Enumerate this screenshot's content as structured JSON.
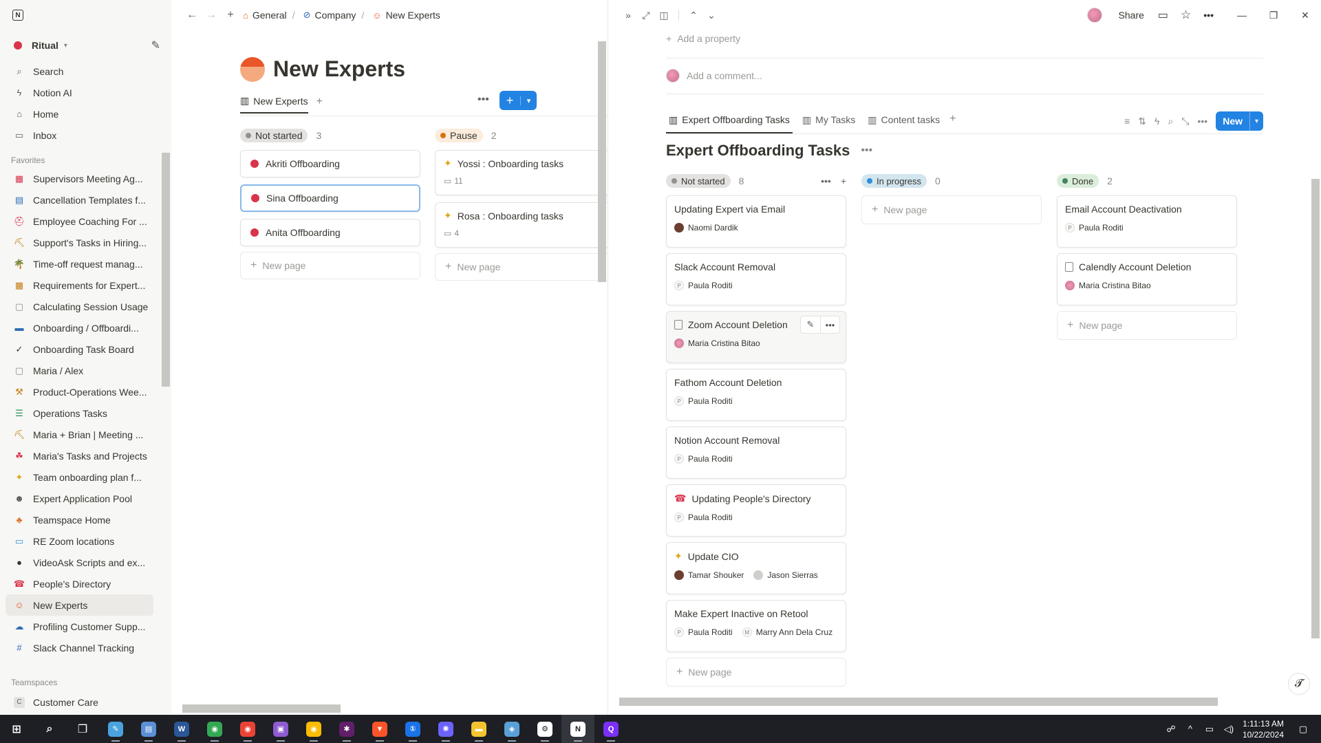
{
  "sidebar": {
    "workspace": "Ritual",
    "nav": [
      {
        "label": "Search",
        "icon": "search-icon"
      },
      {
        "label": "Notion AI",
        "icon": "ai-icon"
      },
      {
        "label": "Home",
        "icon": "home-icon"
      },
      {
        "label": "Inbox",
        "icon": "inbox-icon"
      }
    ],
    "favorites_label": "Favorites",
    "favorites": [
      {
        "label": "Supervisors Meeting Ag...",
        "icon": "▦",
        "color": "#d8344b"
      },
      {
        "label": "Cancellation Templates f...",
        "icon": "▤",
        "color": "#2f6db5"
      },
      {
        "label": "Employee Coaching For ...",
        "icon": "⛑",
        "color": "#d8344b"
      },
      {
        "label": "Support's Tasks in Hiring...",
        "icon": "⛏",
        "color": "#c47d12"
      },
      {
        "label": "Time-off request manag...",
        "icon": "🌴",
        "color": "#2e8b57"
      },
      {
        "label": "Requirements for Expert...",
        "icon": "▦",
        "color": "#c47d12"
      },
      {
        "label": "Calculating Session Usage",
        "icon": "▢",
        "color": "#888888"
      },
      {
        "label": "Onboarding / Offboardi...",
        "icon": "▬",
        "color": "#2f6db5"
      },
      {
        "label": "Onboarding Task Board",
        "icon": "✓",
        "color": "#37352f"
      },
      {
        "label": "Maria / Alex",
        "icon": "▢",
        "color": "#888888"
      },
      {
        "label": "Product-Operations Wee...",
        "icon": "⚒",
        "color": "#c47d12"
      },
      {
        "label": "Operations Tasks",
        "icon": "☰",
        "color": "#2e8b57"
      },
      {
        "label": "Maria + Brian | Meeting ...",
        "icon": "⛏",
        "color": "#c47d12"
      },
      {
        "label": "Maria's Tasks and Projects",
        "icon": "☘",
        "color": "#d8344b"
      },
      {
        "label": "Team onboarding plan f...",
        "icon": "✦",
        "color": "#e0a419"
      },
      {
        "label": "Expert Application Pool",
        "icon": "☻",
        "color": "#555555"
      },
      {
        "label": "Teamspace Home",
        "icon": "♣",
        "color": "#e07020"
      },
      {
        "label": "RE Zoom locations",
        "icon": "▭",
        "color": "#2f8fd8"
      },
      {
        "label": "VideoAsk Scripts and ex...",
        "icon": "●",
        "color": "#37352f"
      },
      {
        "label": "People's Directory",
        "icon": "☎",
        "color": "#d8344b"
      },
      {
        "label": "New Experts",
        "icon": "☺",
        "color": "#e8562a",
        "active": true
      },
      {
        "label": "Profiling Customer Supp...",
        "icon": "☁",
        "color": "#2f6db5"
      },
      {
        "label": "Slack Channel Tracking",
        "icon": "#",
        "color": "#2f6db5"
      }
    ],
    "teamspaces_label": "Teamspaces",
    "teamspace_item": "Customer Care",
    "teamspace_letter": "C"
  },
  "left": {
    "breadcrumbs": [
      "General",
      "Company",
      "New Experts"
    ],
    "title": "New Experts",
    "view_tab": "New Experts",
    "groups": [
      {
        "name": "Not started",
        "count": "3",
        "pill_bg": "#e3e2e0",
        "dot": "#91918e",
        "cards": [
          "Akriti Offboarding",
          "Sina Offboarding",
          "Anita Offboarding"
        ]
      },
      {
        "name": "Pause",
        "count": "2",
        "pill_bg": "#fbecdd",
        "dot": "#d9730d",
        "cards": [
          {
            "title": "Yossi : Onboarding tasks",
            "comments": "11"
          },
          {
            "title": "Rosa : Onboarding tasks",
            "comments": "4"
          }
        ]
      }
    ],
    "new_page": "New page"
  },
  "right": {
    "share": "Share",
    "add_property": "Add a property",
    "comment_placeholder": "Add a comment...",
    "tabs": [
      "Expert Offboarding Tasks",
      "My Tasks",
      "Content tasks"
    ],
    "new_button": "New",
    "db_title": "Expert Offboarding Tasks",
    "new_page": "New page",
    "groups": [
      {
        "name": "Not started",
        "count": "8",
        "pill_bg": "#e3e2e0",
        "dot": "#91918e",
        "cards": [
          {
            "title": "Updating Expert via Email",
            "people": [
              {
                "name": "Naomi Dardik",
                "av": "dark"
              }
            ]
          },
          {
            "title": "Slack Account Removal",
            "people": [
              {
                "name": "Paula Roditi",
                "av": "letter",
                "letter": "P"
              }
            ]
          },
          {
            "title": "Zoom Account Deletion",
            "icon": "doc",
            "hover": true,
            "people": [
              {
                "name": "Maria Cristina Bitao",
                "av": "pink"
              }
            ]
          },
          {
            "title": "Fathom Account Deletion",
            "people": [
              {
                "name": "Paula Roditi",
                "av": "letter",
                "letter": "P"
              }
            ]
          },
          {
            "title": "Notion Account Removal",
            "people": [
              {
                "name": "Paula Roditi",
                "av": "letter",
                "letter": "P"
              }
            ]
          },
          {
            "title": "Updating People's Directory",
            "icon": "☎",
            "people": [
              {
                "name": "Paula Roditi",
                "av": "letter",
                "letter": "P"
              }
            ]
          },
          {
            "title": "Update CIO",
            "icon": "✦",
            "people": [
              {
                "name": "Tamar Shouker",
                "av": "dark"
              },
              {
                "name": "Jason Sierras",
                "av": "gray"
              }
            ]
          },
          {
            "title": "Make Expert Inactive on Retool",
            "people": [
              {
                "name": "Paula Roditi",
                "av": "letter",
                "letter": "P"
              },
              {
                "name": "Marry Ann Dela Cruz",
                "av": "letter",
                "letter": "M"
              }
            ]
          }
        ]
      },
      {
        "name": "In progress",
        "count": "0",
        "pill_bg": "#d3e5ef",
        "dot": "#2f8fd8",
        "cards": []
      },
      {
        "name": "Done",
        "count": "2",
        "pill_bg": "#dbeddb",
        "dot": "#448361",
        "cards": [
          {
            "title": "Email Account Deactivation",
            "people": [
              {
                "name": "Paula Roditi",
                "av": "letter",
                "letter": "P"
              }
            ]
          },
          {
            "title": "Calendly Account Deletion",
            "icon": "doc",
            "people": [
              {
                "name": "Maria Cristina Bitao",
                "av": "pink"
              }
            ]
          }
        ]
      }
    ]
  },
  "taskbar": {
    "time": "1:11:13 AM",
    "date": "10/22/2024",
    "apps": [
      {
        "name": "windows-start-icon",
        "glyph": "⊞",
        "color": "#ffffff"
      },
      {
        "name": "search-icon",
        "glyph": "⌕",
        "color": "#ffffff"
      },
      {
        "name": "task-view-icon",
        "glyph": "❐",
        "color": "#ffffff"
      },
      {
        "name": "notepad-app-icon",
        "glyph": "✎",
        "color": "#4aa3df"
      },
      {
        "name": "files-app-icon",
        "glyph": "▤",
        "color": "#5b8fd6"
      },
      {
        "name": "word-app-icon",
        "glyph": "W",
        "color": "#2b5797"
      },
      {
        "name": "chrome-app-icon",
        "glyph": "◉",
        "color": "#34a853"
      },
      {
        "name": "chrome-app-icon-2",
        "glyph": "◉",
        "color": "#ea4335"
      },
      {
        "name": "photos-app-icon",
        "glyph": "▣",
        "color": "#8e5bd0"
      },
      {
        "name": "chrome-app-icon-3",
        "glyph": "◉",
        "color": "#fbbc05"
      },
      {
        "name": "slack-app-icon",
        "glyph": "✱",
        "color": "#611f69"
      },
      {
        "name": "brave-app-icon",
        "glyph": "▼",
        "color": "#fb542b"
      },
      {
        "name": "password-app-icon",
        "glyph": "①",
        "color": "#1a73e8"
      },
      {
        "name": "settings-app-icon",
        "glyph": "✺",
        "color": "#6c63ff"
      },
      {
        "name": "explorer-app-icon",
        "glyph": "▬",
        "color": "#f4c430"
      },
      {
        "name": "tool-app-icon",
        "glyph": "◈",
        "color": "#5aa0d8"
      },
      {
        "name": "steam-app-icon",
        "glyph": "⚙",
        "color": "#ffffff"
      },
      {
        "name": "notion-app-icon",
        "glyph": "N",
        "color": "#ffffff"
      },
      {
        "name": "terminal-app-icon",
        "glyph": "Q",
        "color": "#7b2ff7"
      }
    ]
  }
}
